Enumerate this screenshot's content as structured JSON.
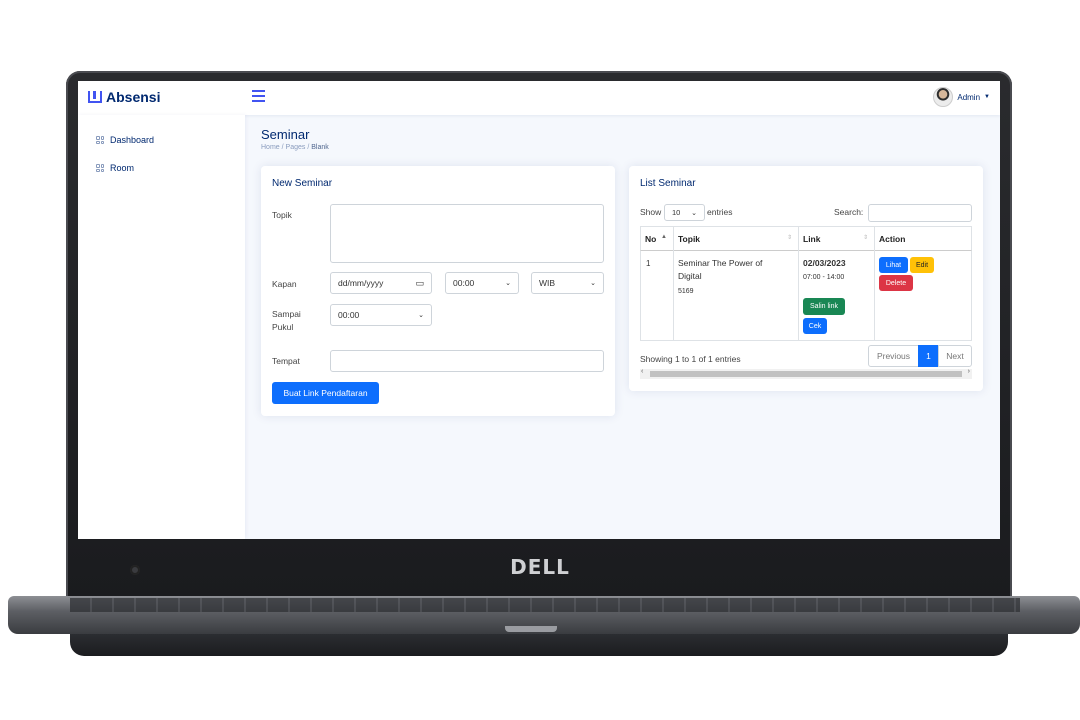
{
  "app": {
    "name": "Absensi",
    "user": "Admin"
  },
  "device": {
    "brand": "DELL"
  },
  "sidebar": {
    "items": [
      {
        "label": "Dashboard"
      },
      {
        "label": "Room"
      }
    ]
  },
  "page": {
    "title": "Seminar",
    "breadcrumb": [
      "Home",
      "Pages",
      "Blank"
    ]
  },
  "form": {
    "title": "New Seminar",
    "labels": {
      "topik": "Topik",
      "kapan": "Kapan",
      "sampai": "Sampai Pukul",
      "tempat": "Tempat"
    },
    "date_placeholder": "dd/mm/yyyy",
    "time_start": "00:00",
    "timezone": "WIB",
    "time_end": "00:00",
    "submit": "Buat Link Pendaftaran"
  },
  "list": {
    "title": "List Seminar",
    "show_label": "Show",
    "page_size": "10",
    "entries_label": "entries",
    "search_label": "Search:",
    "columns": [
      "No",
      "Topik",
      "Link",
      "Action"
    ],
    "rows": [
      {
        "no": "1",
        "topik": "Seminar The Power of Digital",
        "code": "5169",
        "date": "02/03/2023",
        "time": "07:00 - 14:00",
        "copy_btn": "Salin link",
        "check_btn": "Cek",
        "view_btn": "Lihat",
        "edit_btn": "Edit",
        "delete_btn": "Delete"
      }
    ],
    "info": "Showing 1 to 1 of 1 entries",
    "pagination": {
      "prev": "Previous",
      "current": "1",
      "next": "Next"
    }
  },
  "colors": {
    "primary": "#4154f1",
    "navy": "#012970",
    "bg": "#f5f8fd",
    "btn_blue": "#0d6efd"
  }
}
